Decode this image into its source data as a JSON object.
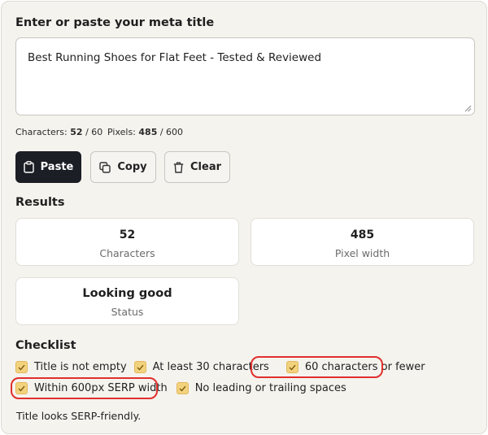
{
  "input": {
    "heading": "Enter or paste your meta title",
    "value": "Best Running Shoes for Flat Feet - Tested & Reviewed"
  },
  "counters": {
    "characters_label": "Characters:",
    "characters_value": "52",
    "characters_limit": "/ 60",
    "pixels_label": "Pixels:",
    "pixels_value": "485",
    "pixels_limit": "/ 600"
  },
  "actions": {
    "paste": {
      "label": "Paste",
      "icon": "clipboard-icon"
    },
    "copy": {
      "label": "Copy",
      "icon": "copy-icon"
    },
    "clear": {
      "label": "Clear",
      "icon": "trash-icon"
    }
  },
  "results": {
    "heading": "Results",
    "cards": [
      {
        "value": "52",
        "label": "Characters"
      },
      {
        "value": "485",
        "label": "Pixel width"
      },
      {
        "value": "Looking good",
        "label": "Status"
      }
    ]
  },
  "checklist": {
    "heading": "Checklist",
    "items": [
      {
        "label": "Title is not empty",
        "checked": true,
        "highlighted": false
      },
      {
        "label": "At least 30 characters",
        "checked": true,
        "highlighted": false
      },
      {
        "label": "60 characters or fewer",
        "checked": true,
        "highlighted": true
      },
      {
        "label": "Within 600px SERP width",
        "checked": true,
        "highlighted": true
      },
      {
        "label": "No leading or trailing spaces",
        "checked": true,
        "highlighted": false
      }
    ]
  },
  "summary": "Title looks SERP-friendly.",
  "colors": {
    "accent_dark": "#1b1e24",
    "check_fill": "#f3d27e",
    "highlight_ring": "#e0302e",
    "panel_bg": "#f5f3ee"
  }
}
